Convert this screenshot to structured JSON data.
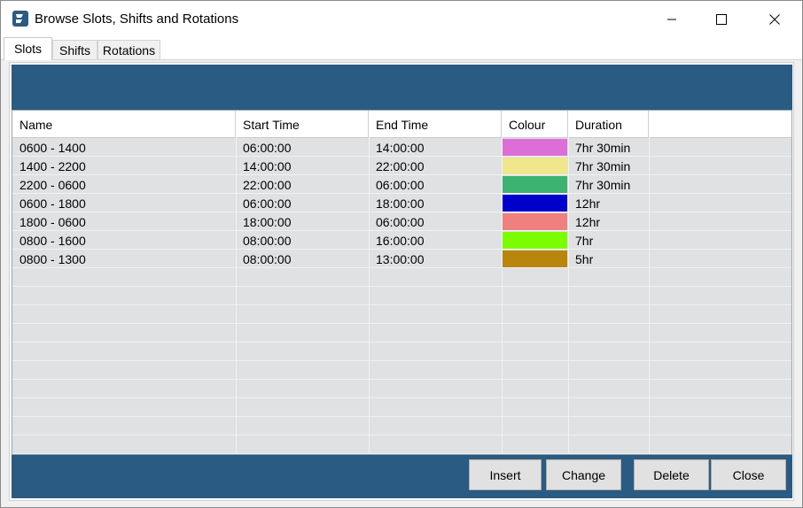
{
  "window": {
    "title": "Browse Slots, Shifts and Rotations"
  },
  "tabs": [
    {
      "label": "Slots",
      "active": true
    },
    {
      "label": "Shifts",
      "active": false
    },
    {
      "label": "Rotations",
      "active": false
    }
  ],
  "grid": {
    "columns": [
      "Name",
      "Start Time",
      "End Time",
      "Colour",
      "Duration"
    ],
    "rows": [
      {
        "name": "0600 - 1400",
        "start": "06:00:00",
        "end": "14:00:00",
        "colour": "#dd6ed8",
        "duration": "7hr 30min"
      },
      {
        "name": "1400 - 2200",
        "start": "14:00:00",
        "end": "22:00:00",
        "colour": "#f0e68c",
        "duration": "7hr 30min"
      },
      {
        "name": "2200 - 0600",
        "start": "22:00:00",
        "end": "06:00:00",
        "colour": "#3cb371",
        "duration": "7hr 30min"
      },
      {
        "name": "0600 - 1800",
        "start": "06:00:00",
        "end": "18:00:00",
        "colour": "#0000cd",
        "duration": "12hr"
      },
      {
        "name": "1800 - 0600",
        "start": "18:00:00",
        "end": "06:00:00",
        "colour": "#f08080",
        "duration": "12hr"
      },
      {
        "name": "0800 - 1600",
        "start": "08:00:00",
        "end": "16:00:00",
        "colour": "#7cfc00",
        "duration": "7hr"
      },
      {
        "name": "0800 - 1300",
        "start": "08:00:00",
        "end": "13:00:00",
        "colour": "#b8860b",
        "duration": "5hr"
      }
    ]
  },
  "buttons": {
    "insert": "Insert",
    "change": "Change",
    "delete": "Delete",
    "close": "Close"
  },
  "colors": {
    "panel_blue": "#2a5b82",
    "grid_bg": "#dfe1e3"
  }
}
